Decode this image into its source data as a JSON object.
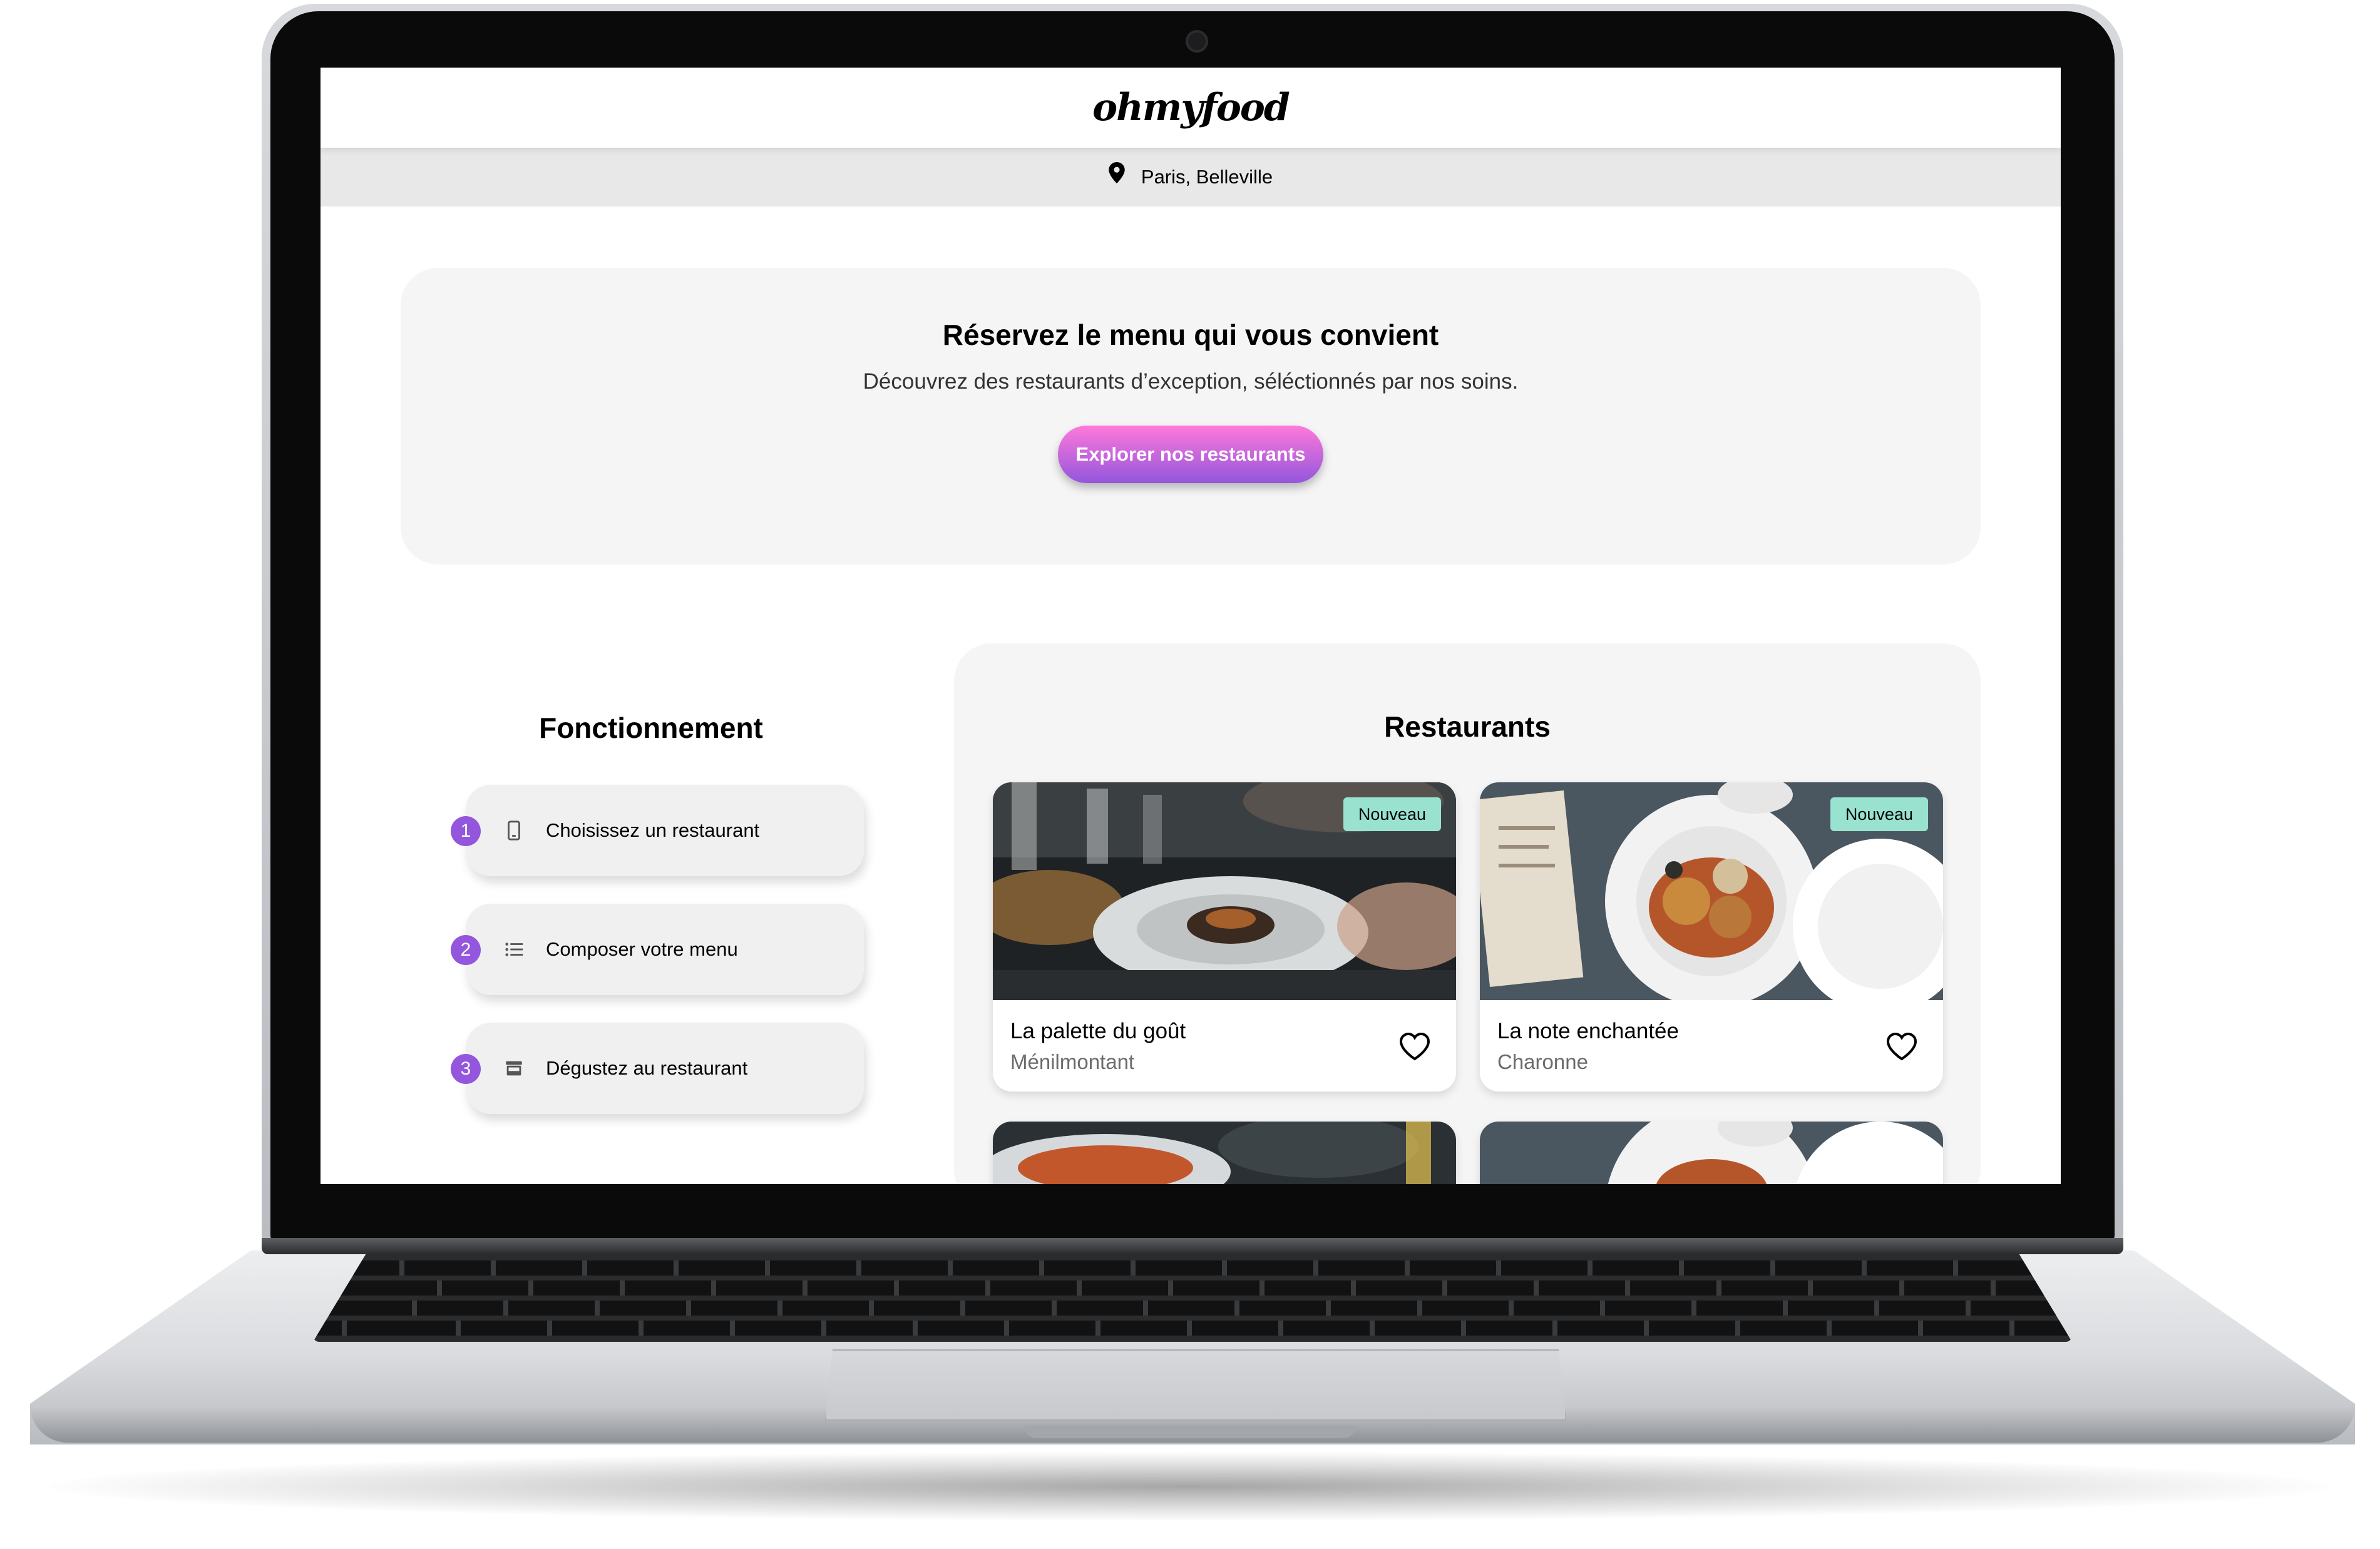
{
  "header": {
    "logo": "ohmyfood"
  },
  "location": {
    "icon": "map-pin-icon",
    "text": "Paris, Belleville"
  },
  "hero": {
    "title": "Réservez le menu qui vous convient",
    "subtitle": "Découvrez des restaurants d’exception, séléctionnés par nos soins.",
    "button_label": "Explorer nos restaurants"
  },
  "how_it_works": {
    "title": "Fonctionnement",
    "steps": [
      {
        "number": "1",
        "icon": "smartphone-icon",
        "label": "Choisissez un restaurant"
      },
      {
        "number": "2",
        "icon": "list-icon",
        "label": "Composer votre menu"
      },
      {
        "number": "3",
        "icon": "store-icon",
        "label": "Dégustez au restaurant"
      }
    ]
  },
  "restaurants": {
    "title": "Restaurants",
    "items": [
      {
        "name": "La palette du goût",
        "area": "Ménilmontant",
        "badge": "Nouveau"
      },
      {
        "name": "La note enchantée",
        "area": "Charonne",
        "badge": "Nouveau"
      }
    ]
  },
  "colors": {
    "accent_gradient_start": "#ff79da",
    "accent_gradient_end": "#9356dc",
    "badge": "#99e2d0",
    "step_number": "#9356dc"
  }
}
